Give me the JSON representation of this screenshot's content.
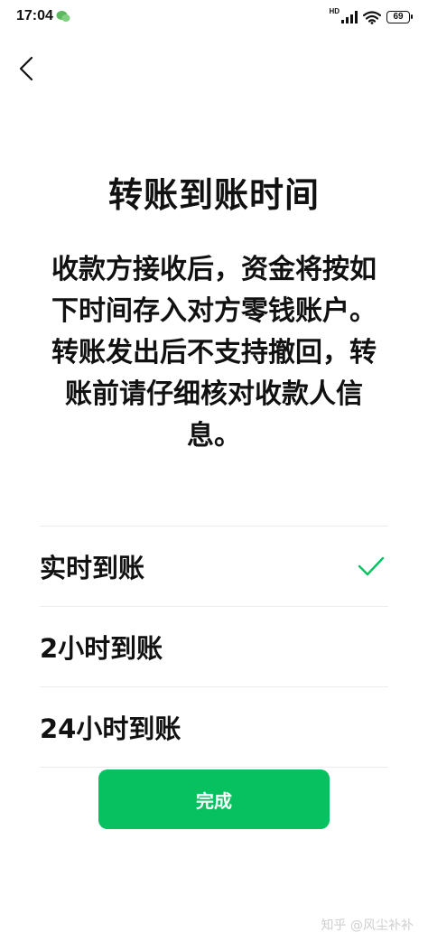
{
  "status_bar": {
    "time": "17:04",
    "network_label": "HD",
    "battery_level": "69",
    "icons": [
      "wechat-notification-icon",
      "signal-icon",
      "wifi-icon",
      "battery-icon"
    ]
  },
  "header": {
    "back_icon": "chevron-left-icon"
  },
  "page": {
    "title": "转账到账时间",
    "description": "收款方接收后，资金将按如下时间存入对方零钱账户。转账发出后不支持撤回，转账前请仔细核对收款人信息。"
  },
  "options": [
    {
      "label": "实时到账",
      "selected": true
    },
    {
      "label": "2小时到账",
      "selected": false
    },
    {
      "label": "24小时到账",
      "selected": false
    }
  ],
  "actions": {
    "done_label": "完成"
  },
  "watermark": {
    "text": "知乎 @风尘补补"
  },
  "colors": {
    "accent": "#07c160",
    "text": "#111111",
    "divider": "#ececec",
    "background": "#ffffff"
  }
}
